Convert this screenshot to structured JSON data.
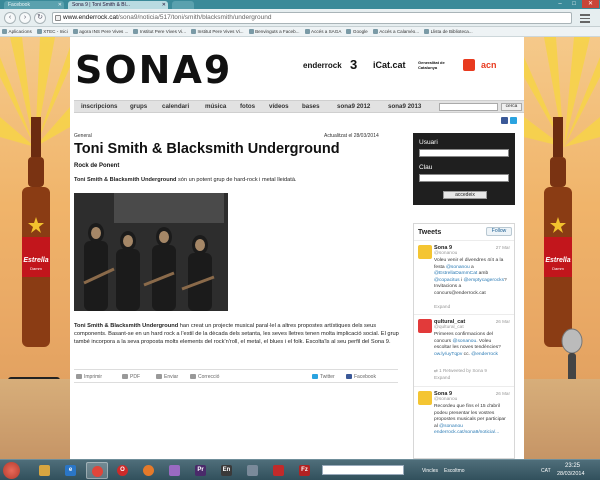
{
  "browser": {
    "tabs": [
      {
        "label": "Facebook"
      },
      {
        "label": "Sona 9 | Toni Smith & Bl..."
      },
      {
        "label": ""
      }
    ],
    "url_host": "www.enderrock.cat",
    "url_path": "/sona9/noticia/517/toni/smith/blacksmith/underground",
    "bookmarks": [
      "Aplicacions",
      "XTEC - Inici",
      "agora INS Pere Vives ...",
      "Institut Pere Vives Vi...",
      "Institut Pere Vives Vi...",
      "Benvinguts a Faceb...",
      "Accés a SAGA",
      "Google",
      "Accés a Calaméo...",
      "Llista de Biblioteca..."
    ]
  },
  "site": {
    "logo_text": "SONA9",
    "partners": [
      "enderrock",
      "3",
      "iCat.cat",
      "Generalitat de Catalunya",
      "acn"
    ],
    "nav": [
      "inscripcions",
      "grups",
      "calendari",
      "música",
      "fotos",
      "vídeos",
      "bases",
      "sona9 2012",
      "sona9 2013"
    ],
    "search_button": "cerca"
  },
  "article": {
    "category": "General",
    "updated": "Actualitzat el 28/03/2014",
    "title": "Toni Smith & Blacksmith Underground",
    "subtitle": "Rock de Ponent",
    "lead_bold": "Toni Smith & Blacksmith Underground",
    "lead_rest": " són un potent grup de hard-rock i metal lleidatà.",
    "body_bold": "Toni Smith & Blacksmith Underground",
    "body_rest": " han creat un projecte musical paral·lel a altres propostes artístiques dels seus components. Basant-se en un hard rock a l'estil de la dècada dels setanta, les seves lletres tenen molta implicació social. El grup també incorpora a la seva proposta molts elements del rock'n'roll, el metal, el blues i el folk. Escolta'ls al seu perfil del Sona 9.",
    "share": [
      "Imprimir",
      "PDF",
      "Enviar",
      "Correcció",
      "Twitter",
      "Facebook"
    ]
  },
  "login": {
    "user_label": "Usuari",
    "pass_label": "Clau",
    "button": "accedeix"
  },
  "tweets": {
    "header": "Tweets",
    "follow": "Follow",
    "items": [
      {
        "name": "Sona 9",
        "handle": "@sonanou",
        "date": "27 Mar",
        "text_plain_1": "Voleu venir el divendres 4/4 a la festa ",
        "link_1": "@sonanou",
        "text_plain_2": " a ",
        "link_2": "@EstrellaDammCat",
        "text_plain_3": " amb ",
        "link_3": "@copacitus",
        "text_plain_4": " i ",
        "link_4": "@emptycagerocks",
        "text_plain_5": "? Invitacions a concurs@enderrock.cat",
        "expand": "Expand"
      },
      {
        "name": "qultural_cat",
        "handle": "@qultural_cat",
        "date": "26 Mar",
        "text_plain_1": "Primeres confirmacions del concurs ",
        "link_1": "@sonanou",
        "text_plain_2": ". Voleu escoltar les noves tendències? ",
        "link_2": "ow.ly/uyTqpv",
        "text_plain_3": " cc. ",
        "link_3": "@enderrock",
        "retweet": "Retweeted by Sona 9",
        "retweet_count": "1",
        "expand": "Expand"
      },
      {
        "name": "Sona 9",
        "handle": "@sonanou",
        "date": "26 Mar",
        "text_plain_1": "Recordeu que fins el 15 d'abril podeu presentar les vostres propostes musicals per participar al ",
        "link_1": "@sonanou",
        "text_plain_2": " ",
        "link_2": "enderrock.cat/sona9/noticia/..."
      }
    ]
  },
  "taskbar": {
    "tray_links": "Vincles",
    "tray_listen": "Escoltmo",
    "lang": "CAT",
    "time": "23:25",
    "date": "28/03/2014"
  },
  "colors": {
    "accent_blue": "#2a7ab4",
    "login_bg": "#1f1f1f",
    "nav_bg": "#e2e2e2"
  }
}
